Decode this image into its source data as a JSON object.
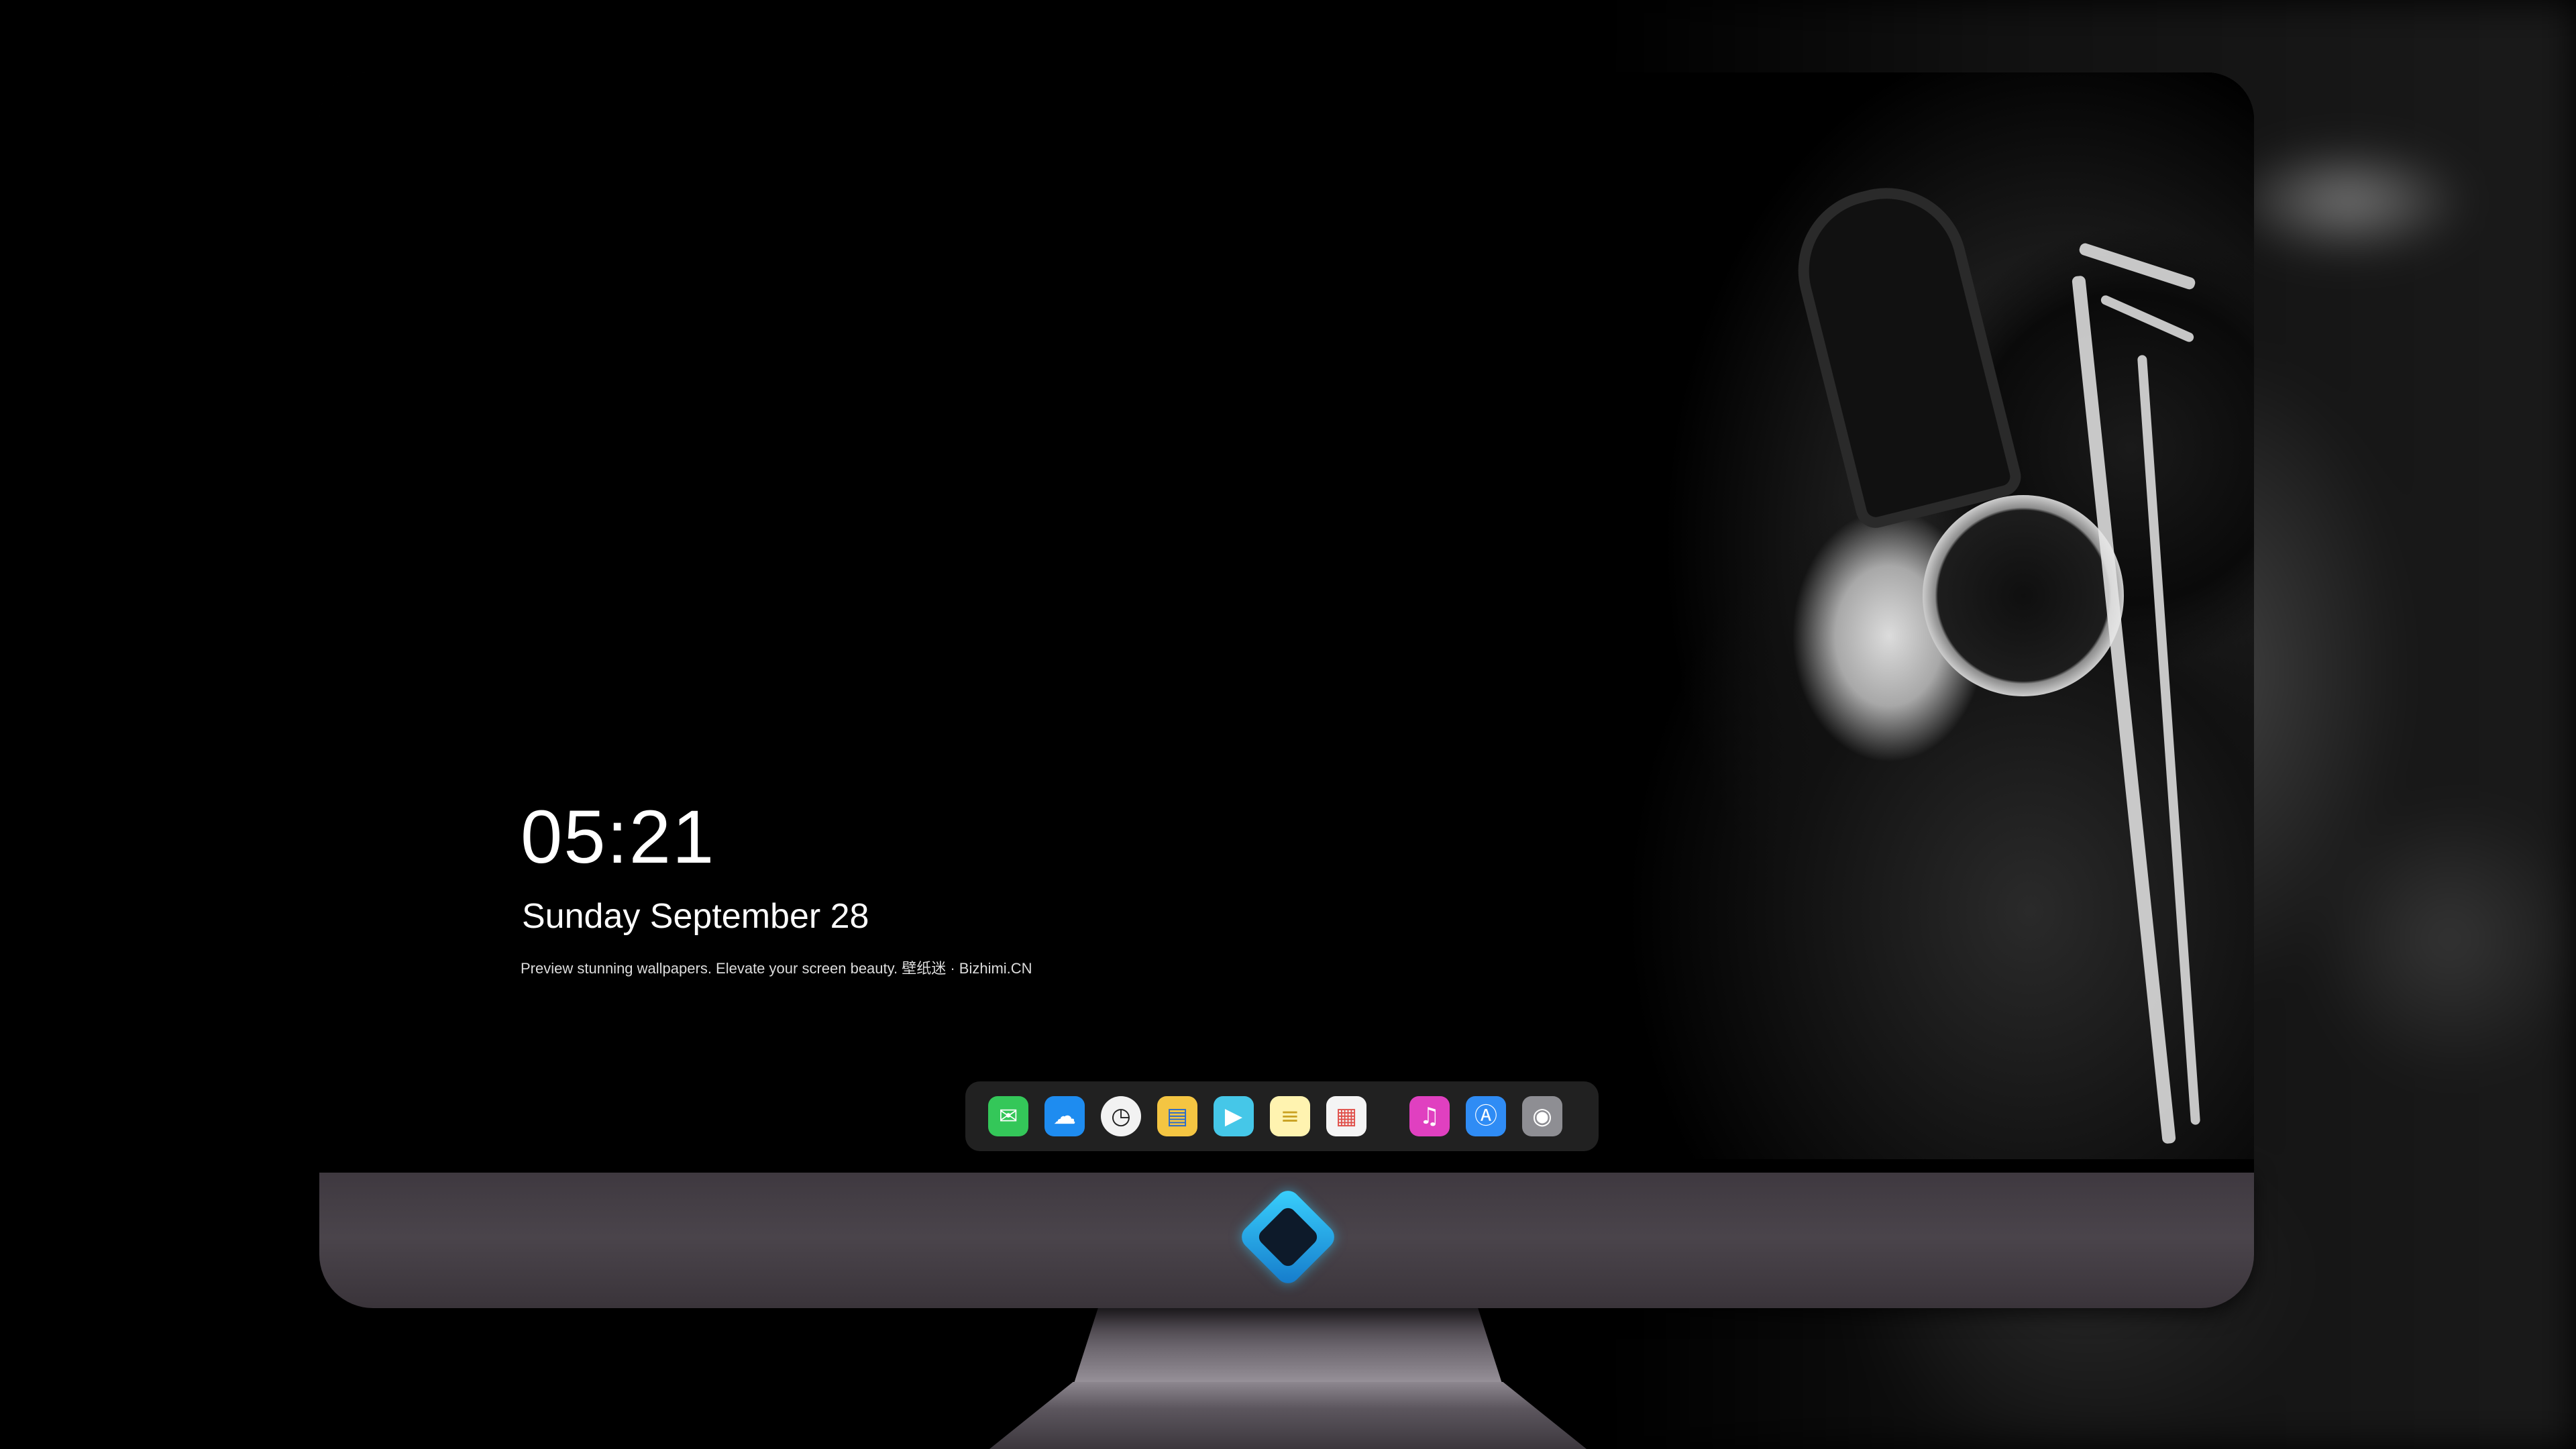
{
  "lock_screen": {
    "time": "05:21",
    "date": "Sunday September  28",
    "tagline": "Preview stunning wallpapers. Elevate your screen beauty. 壁纸迷 · Bizhimi.CN"
  },
  "dock": {
    "apps": [
      {
        "name": "messages-icon",
        "color": "#34c759",
        "glyph": "💬"
      },
      {
        "name": "weather-icon",
        "color": "#1e8cf0",
        "glyph": "☁"
      },
      {
        "name": "clock-icon",
        "color": "#f2f2f2",
        "glyph": "🕓"
      },
      {
        "name": "maps-icon",
        "color": "#f4c542",
        "glyph": "🗺"
      },
      {
        "name": "video-clips-icon",
        "color": "#45c7e8",
        "glyph": "🎬"
      },
      {
        "name": "notes-icon",
        "color": "#fff3b0",
        "glyph": "≡"
      },
      {
        "name": "photos-icon",
        "color": "#f4f4f4",
        "glyph": "▦"
      },
      {
        "name": "music-icon",
        "color": "#e040c0",
        "glyph": "♫"
      },
      {
        "name": "app-store-icon",
        "color": "#2f8cf5",
        "glyph": "Ⓐ"
      },
      {
        "name": "camera-icon",
        "color": "#8e8e93",
        "glyph": "📷"
      }
    ]
  },
  "monitor": {
    "logo": "bizhimi-logo-icon",
    "bezel_color": "#0a0a0a",
    "chin_color": "#443e45"
  }
}
